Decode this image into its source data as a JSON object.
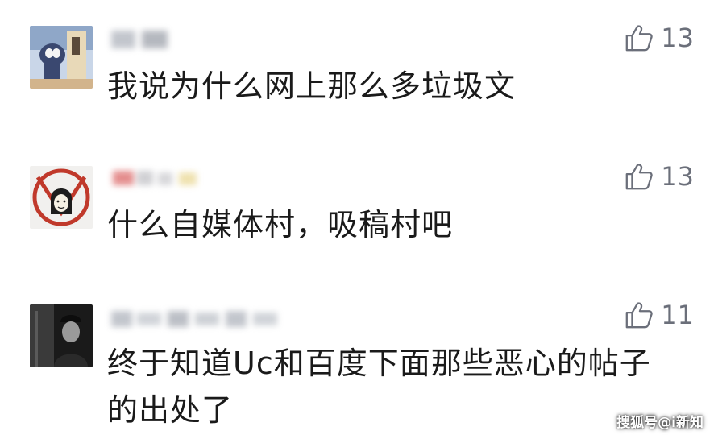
{
  "comments": [
    {
      "username": "",
      "like_count": "13",
      "text": "我说为什么网上那么多垃圾文"
    },
    {
      "username": "",
      "like_count": "13",
      "text": "什么自媒体村，吸稿村吧"
    },
    {
      "username": "",
      "like_count": "11",
      "text": "终于知道Uc和百度下面那些恶心的帖子的出处了"
    }
  ],
  "watermark": "搜狐号@i新知",
  "colors": {
    "text": "#1a1a1a",
    "like": "#6b6f7a",
    "background": "#ffffff"
  },
  "icons": {
    "like": "thumbs-up-icon"
  }
}
